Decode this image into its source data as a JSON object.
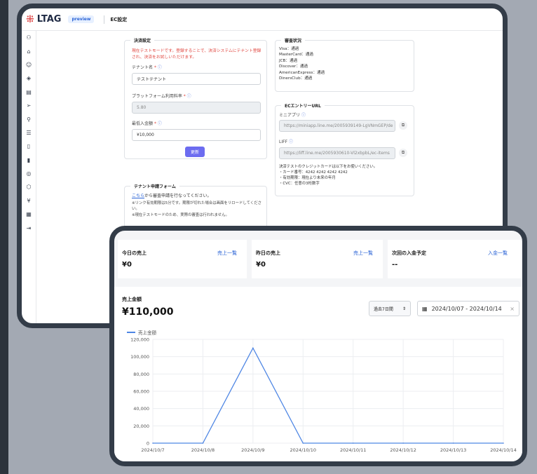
{
  "back": {
    "logo": "LTAG",
    "preview": "preview",
    "page_title": "EC設定",
    "sidebar_icons": [
      "users-icon",
      "tag-icon",
      "smile-icon",
      "tag-alt-icon",
      "table-icon",
      "send-icon",
      "org-chart-icon",
      "list-icon",
      "file-icon",
      "bar-chart-icon",
      "target-icon",
      "box-icon",
      "yen-icon",
      "calculator-icon",
      "logout-icon"
    ],
    "payment": {
      "legend": "決済設定",
      "warning": "現在テストモードです。登録することで、決済システムにテナント登録され、決済をお試しいただけます。",
      "tenant_label": "テナント名",
      "tenant_value": "テストテナント",
      "fee_label": "プラットフォーム利用料率",
      "fee_value": "5.80",
      "min_label": "最低入金額",
      "min_value": "¥10,000",
      "update": "更新"
    },
    "apply": {
      "legend": "テナント申請フォーム",
      "link": "こちら",
      "text": "から審査申請を行なってください。",
      "note": "※リンク有効期限は5分です。期限が切れた場合は画面をリロードしてください。",
      "warn": "※現在テストモードのため、実際の審査は行われません。"
    },
    "review": {
      "legend": "審査状況",
      "items": [
        "Visa：通過",
        "MasterCard：通過",
        "JCB：通過",
        "Discover：通過",
        "AmericanExpress：通過",
        "DinersClub：通過"
      ]
    },
    "ec_url": {
      "legend": "ECエントリーURL",
      "mini_label": "ミニアプリ",
      "mini_url": "https://miniapp.line.me/2005939149-LgVNmGEP/de",
      "liff_label": "LIFF",
      "liff_url": "https://liff.line.me/2005930610-Vl2xbpbL/ec-items",
      "note_lines": [
        "決済テストのクレジットカードは以下をお使いください。",
        "・カード番号：4242 4242 4242 4242",
        "・有効期限：現在より未来の年月",
        "・CVC：任意の3桁数字"
      ]
    }
  },
  "front": {
    "cards": [
      {
        "title": "今日の売上",
        "link": "売上一覧",
        "value": "¥0"
      },
      {
        "title": "昨日の売上",
        "link": "売上一覧",
        "value": "¥0"
      },
      {
        "title": "次回の入金予定",
        "link": "入金一覧",
        "value": "--"
      }
    ],
    "sales_title": "売上金額",
    "sales_total": "¥110,000",
    "period": "過去7日間",
    "date_range": "2024/10/07 - 2024/10/14"
  },
  "chart_data": {
    "type": "line",
    "legend": "売上金額",
    "categories": [
      "2024/10/7",
      "2024/10/8",
      "2024/10/9",
      "2024/10/10",
      "2024/10/11",
      "2024/10/12",
      "2024/10/13",
      "2024/10/14"
    ],
    "series": [
      {
        "name": "売上金額",
        "values": [
          0,
          0,
          110000,
          0,
          0,
          0,
          0,
          0
        ]
      }
    ],
    "yticks": [
      "0",
      "20,000",
      "40,000",
      "60,000",
      "80,000",
      "100,000",
      "120,000"
    ],
    "ylim": [
      0,
      120000
    ],
    "color": "#4e86e4",
    "grid": true
  }
}
